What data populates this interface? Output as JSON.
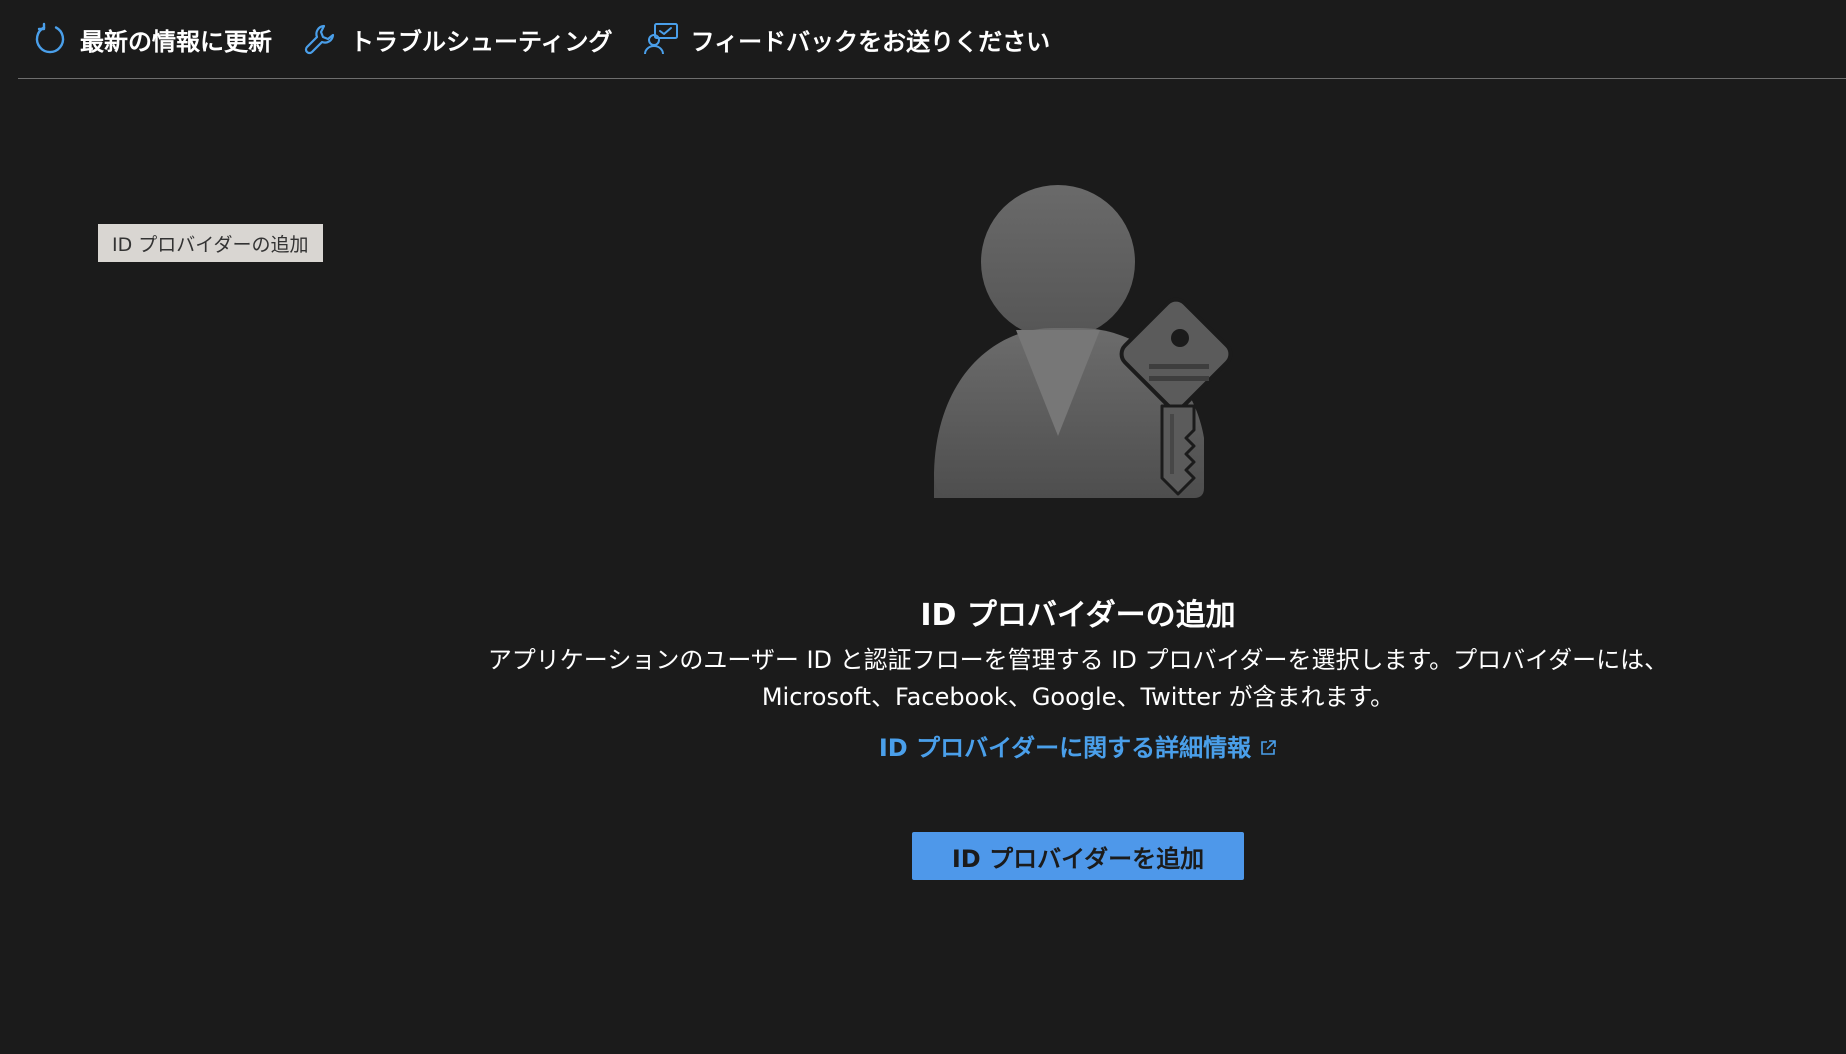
{
  "toolbar": {
    "refresh_label": "最新の情報に更新",
    "troubleshoot_label": "トラブルシューティング",
    "feedback_label": "フィードバックをお送りください"
  },
  "tooltip": {
    "text": "ID プロバイダーの追加"
  },
  "hero": {
    "title": "ID プロバイダーの追加",
    "description_line1": "アプリケーションのユーザー ID と認証フローを管理する ID プロバイダーを選択します。プロバイダーには、",
    "description_line2": "Microsoft、Facebook、Google、Twitter が含まれます。",
    "learn_more_link": "ID プロバイダーに関する詳細情報",
    "add_button_label": "ID プロバイダーを追加"
  },
  "colors": {
    "background": "#1b1b1b",
    "accent": "#4e98ea",
    "link": "#4a9fea",
    "icon_gray": "#5a5a5a"
  }
}
